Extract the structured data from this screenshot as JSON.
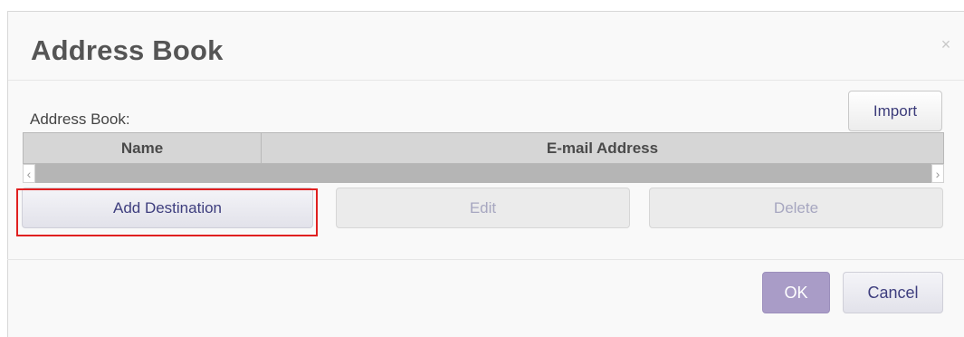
{
  "dialog": {
    "title": "Address Book",
    "close_icon": "close-icon",
    "close_glyph": "×"
  },
  "address_book": {
    "label": "Address Book:",
    "import_label": "Import"
  },
  "table": {
    "columns": [
      "Name",
      "E-mail Address"
    ],
    "rows": [],
    "scroll_left_glyph": "‹",
    "scroll_right_glyph": "›"
  },
  "actions": {
    "add_label": "Add Destination",
    "edit_label": "Edit",
    "delete_label": "Delete"
  },
  "footer": {
    "ok_label": "OK",
    "cancel_label": "Cancel"
  },
  "colors": {
    "highlight": "#e02020",
    "primary": "#a99cc7"
  }
}
